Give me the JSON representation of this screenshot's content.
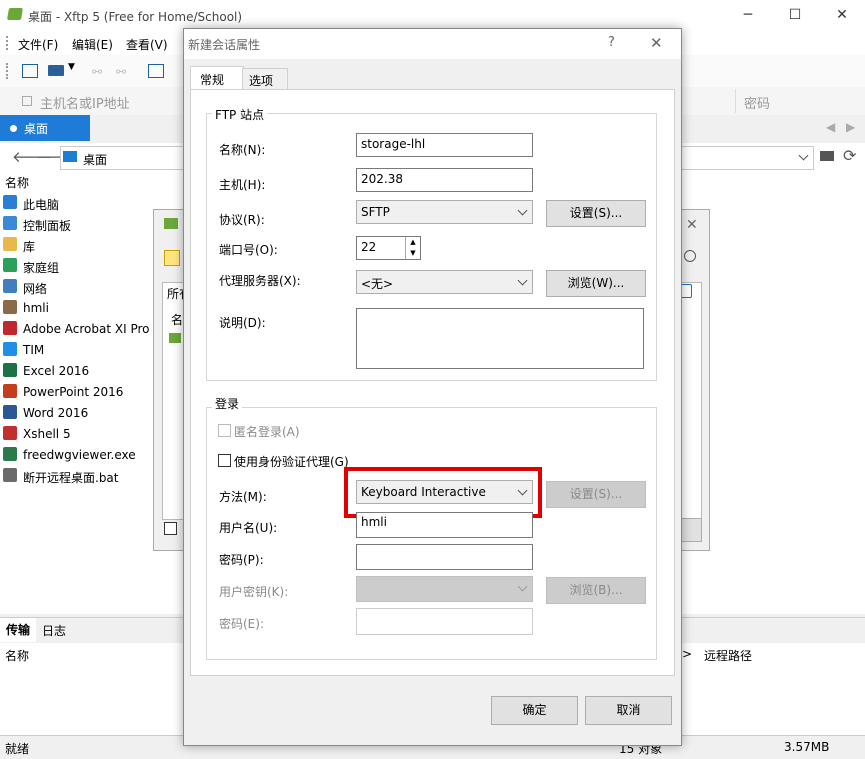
{
  "app": {
    "title": "桌面 - Xftp 5 (Free for Home/School)",
    "menu": [
      "文件(F)",
      "编辑(E)",
      "查看(V)"
    ],
    "address_placeholder": "主机名或IP地址",
    "password_placeholder": "密码",
    "tab_label": "桌面",
    "path": "桌面",
    "left_header": "名称",
    "left_items": [
      {
        "label": "此电脑",
        "icon": "computer-icon"
      },
      {
        "label": "控制面板",
        "icon": "control-panel-icon"
      },
      {
        "label": "库",
        "icon": "library-icon"
      },
      {
        "label": "家庭组",
        "icon": "homegroup-icon"
      },
      {
        "label": "网络",
        "icon": "network-icon"
      },
      {
        "label": "hmli",
        "icon": "user-icon"
      },
      {
        "label": "Adobe Acrobat XI Pro",
        "icon": "acrobat-icon"
      },
      {
        "label": "TIM",
        "icon": "tim-icon"
      },
      {
        "label": "Excel 2016",
        "icon": "excel-icon"
      },
      {
        "label": "PowerPoint 2016",
        "icon": "powerpoint-icon"
      },
      {
        "label": "Word 2016",
        "icon": "word-icon"
      },
      {
        "label": "Xshell 5",
        "icon": "xshell-icon"
      },
      {
        "label": "freedwgviewer.exe",
        "icon": "exe-icon"
      },
      {
        "label": "断开远程桌面.bat",
        "icon": "bat-icon"
      }
    ],
    "back_dialog": {
      "frag1": "所有",
      "frag2": "名"
    },
    "bottom_tabs": [
      "传输",
      "日志"
    ],
    "bottom_headers": {
      "name": "名称",
      "arrow": ">",
      "remote_path": "远程路径"
    },
    "status": {
      "ready": "就绪",
      "objects": "15 对象",
      "size": "3.57MB"
    }
  },
  "dialog": {
    "title": "新建会话属性",
    "help": "?",
    "tabs": [
      "常规",
      "选项"
    ],
    "ftp_group": "FTP 站点",
    "name_label": "名称(N):",
    "name_value": "storage-lhl",
    "host_label": "主机(H):",
    "host_value": "202.38",
    "protocol_label": "协议(R):",
    "protocol_value": "SFTP",
    "settings_button": "设置(S)...",
    "port_label": "端口号(O):",
    "port_value": "22",
    "proxy_label": "代理服务器(X):",
    "proxy_value": "<无>",
    "browse_button": "浏览(W)...",
    "desc_label": "说明(D):",
    "login_group": "登录",
    "anon_label": "匿名登录(A)",
    "agent_label": "使用身份验证代理(G)",
    "method_label": "方法(M):",
    "method_value": "Keyboard Interactive",
    "method_settings": "设置(S)...",
    "user_label": "用户名(U):",
    "user_value": "hmli",
    "pass_label": "密码(P):",
    "key_label": "用户密钥(K):",
    "key_browse": "浏览(B)...",
    "passphrase_label": "密码(E):",
    "ok": "确定",
    "cancel": "取消",
    "highlight_color": "#e00000"
  }
}
